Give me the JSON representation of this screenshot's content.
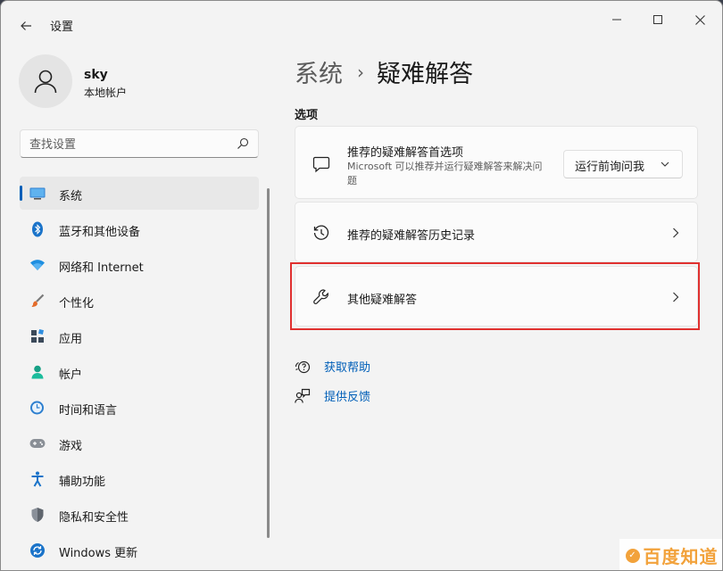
{
  "window": {
    "title": "设置"
  },
  "profile": {
    "name": "sky",
    "account_type": "本地帐户"
  },
  "search": {
    "placeholder": "查找设置"
  },
  "nav": {
    "items": [
      {
        "label": "系统",
        "icon": "system-icon",
        "selected": true
      },
      {
        "label": "蓝牙和其他设备",
        "icon": "bluetooth-icon"
      },
      {
        "label": "网络和 Internet",
        "icon": "network-icon"
      },
      {
        "label": "个性化",
        "icon": "personalization-brush-icon"
      },
      {
        "label": "应用",
        "icon": "apps-icon"
      },
      {
        "label": "帐户",
        "icon": "accounts-icon"
      },
      {
        "label": "时间和语言",
        "icon": "time-language-icon"
      },
      {
        "label": "游戏",
        "icon": "gaming-icon"
      },
      {
        "label": "辅助功能",
        "icon": "accessibility-icon"
      },
      {
        "label": "隐私和安全性",
        "icon": "privacy-shield-icon"
      },
      {
        "label": "Windows 更新",
        "icon": "windows-update-icon"
      }
    ]
  },
  "breadcrumb": {
    "parent": "系统",
    "separator": "›",
    "current": "疑难解答"
  },
  "section": {
    "title": "选项"
  },
  "cards": {
    "recommended": {
      "title": "推荐的疑难解答首选项",
      "description": "Microsoft 可以推荐并运行疑难解答来解决问题",
      "dropdown_value": "运行前询问我",
      "icon": "message-icon"
    },
    "history": {
      "title": "推荐的疑难解答历史记录",
      "icon": "history-icon"
    },
    "other": {
      "title": "其他疑难解答",
      "icon": "wrench-icon"
    }
  },
  "links": {
    "get_help": "获取帮助",
    "feedback": "提供反馈"
  },
  "watermark": {
    "badge": "✓",
    "text": "百度知道"
  },
  "colors": {
    "accent": "#005fb8",
    "highlight_border": "#e0302f",
    "background": "#f3f3f3",
    "card": "#fbfbfb"
  }
}
